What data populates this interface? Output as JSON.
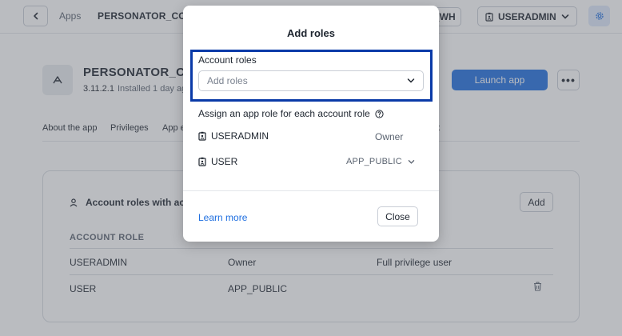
{
  "topbar": {
    "apps_crumb": "Apps",
    "app_crumb": "PERSONATOR_CONS",
    "warehouse": "P_WH",
    "role": "USERADMIN"
  },
  "app": {
    "name": "PERSONATOR_CO",
    "version": "3.11.2.1",
    "installed": "Installed 1 day ag",
    "launch_label": "Launch app",
    "more_label": "•••"
  },
  "tabs": [
    "About the app",
    "Privileges",
    "App e",
    "nt"
  ],
  "card": {
    "title": "Account roles with acc",
    "add_label": "Add",
    "columns": [
      "ACCOUNT ROLE"
    ],
    "rows": [
      {
        "role": "USERADMIN",
        "app_role": "Owner",
        "description": "Full privilege user"
      },
      {
        "role": "USER",
        "app_role": "APP_PUBLIC",
        "description": ""
      }
    ]
  },
  "modal": {
    "title": "Add roles",
    "field_label": "Account roles",
    "placeholder": "Add roles",
    "assign_text": "Assign an app role for each account role",
    "role_rows": [
      {
        "name": "USERADMIN",
        "app_role": "Owner"
      },
      {
        "name": "USER",
        "app_role": "APP_PUBLIC"
      }
    ],
    "learn_more": "Learn more",
    "close_label": "Close"
  },
  "colors": {
    "accent": "#1f6fe0",
    "highlight_border": "#0a3aa8",
    "overlay": "rgba(90,96,104,0.42)"
  },
  "icons": [
    "chevron-left-icon",
    "badge-icon",
    "chevron-down-icon",
    "gear-icon",
    "app-logo-icon",
    "user-icon",
    "trash-icon",
    "help-circle-icon"
  ]
}
